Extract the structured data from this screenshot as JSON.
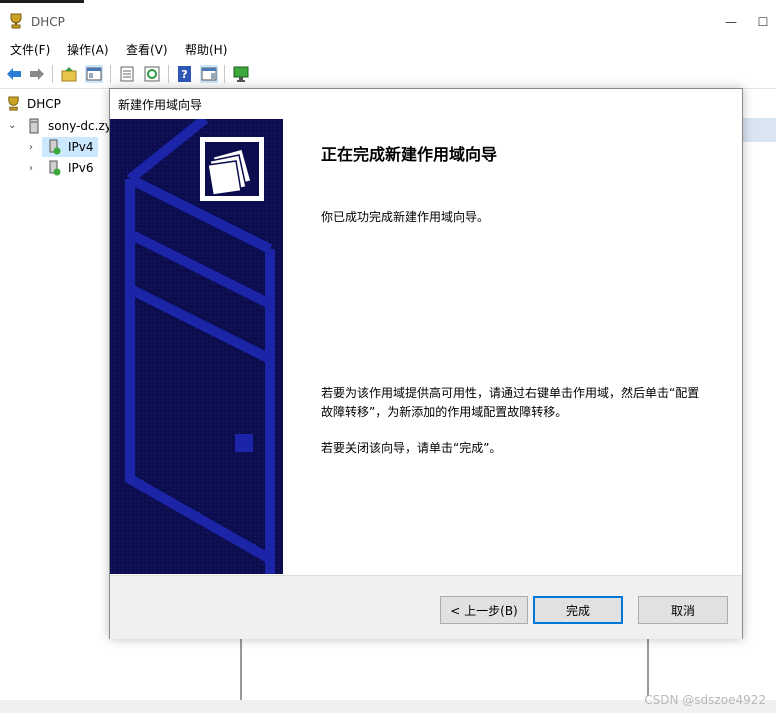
{
  "window": {
    "title": "DHCP"
  },
  "menu": [
    "文件(F)",
    "操作(A)",
    "查看(V)",
    "帮助(H)"
  ],
  "toolbar": [
    "back-icon",
    "forward-icon",
    "up-folder-icon",
    "show-hide-tree-icon",
    "properties-icon",
    "refresh-icon",
    "help-icon",
    "show-action-pane-icon",
    "monitor-icon"
  ],
  "tree": {
    "root": "DHCP",
    "server": "sony-dc.zy",
    "children": [
      "IPv4",
      "IPv6"
    ]
  },
  "dialog": {
    "title": "新建作用域向导",
    "heading": "正在完成新建作用域向导",
    "line1": "你已成功完成新建作用域向导。",
    "line2": "若要为该作用域提供高可用性，请通过右键单击作用域，然后单击“配置故障转移”，为新添加的作用域配置故障转移。",
    "line3": "若要关闭该向导，请单击“完成”。",
    "buttons": {
      "back": "< 上一步(B)",
      "finish": "完成",
      "cancel": "取消"
    }
  },
  "watermark": "CSDN @sdszoe4922",
  "colors": {
    "banner": "#0b0d4f",
    "selection": "#cce8ff",
    "default_button_border": "#0078d7"
  }
}
